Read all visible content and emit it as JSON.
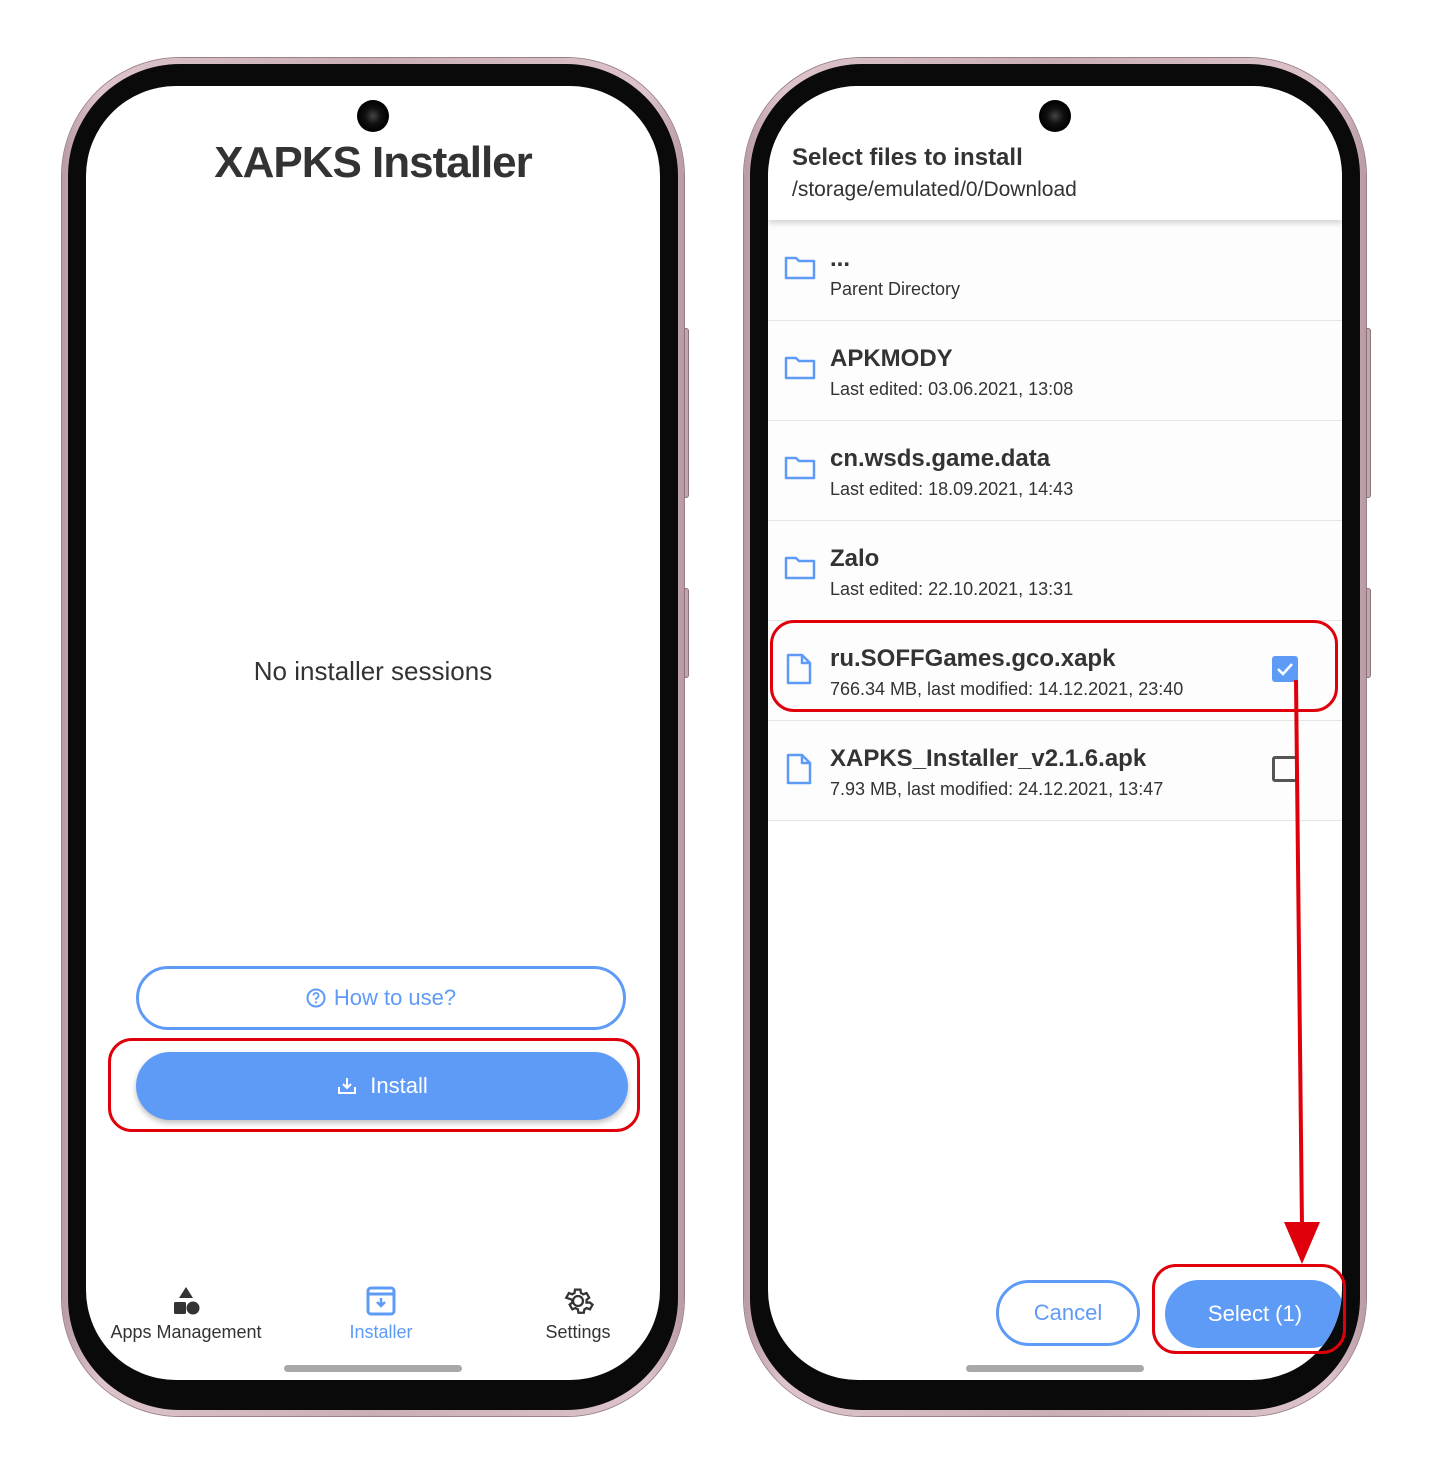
{
  "left_screen": {
    "app_title": "XAPKS Installer",
    "empty_state": "No installer sessions",
    "how_to_use_label": "How to use?",
    "install_label": "Install",
    "nav": [
      {
        "label": "Apps Management",
        "icon": "shapes-icon",
        "active": false
      },
      {
        "label": "Installer",
        "icon": "installer-icon",
        "active": true
      },
      {
        "label": "Settings",
        "icon": "gear-icon",
        "active": false
      }
    ]
  },
  "right_screen": {
    "dialog_title": "Select files to install",
    "path": "/storage/emulated/0/Download",
    "items": [
      {
        "type": "folder",
        "name": "...",
        "meta": "Parent Directory"
      },
      {
        "type": "folder",
        "name": "APKMODY",
        "meta": "Last edited: 03.06.2021, 13:08"
      },
      {
        "type": "folder",
        "name": "cn.wsds.game.data",
        "meta": "Last edited: 18.09.2021, 14:43"
      },
      {
        "type": "folder",
        "name": "Zalo",
        "meta": "Last edited: 22.10.2021, 13:31"
      },
      {
        "type": "file",
        "name": "ru.SOFFGames.gco.xapk",
        "meta": "766.34 MB, last modified: 14.12.2021, 23:40",
        "checked": true
      },
      {
        "type": "file",
        "name": "XAPKS_Installer_v2.1.6.apk",
        "meta": "7.93 MB, last modified: 24.12.2021, 13:47",
        "checked": false
      }
    ],
    "cancel_label": "Cancel",
    "select_label": "Select (1)"
  },
  "colors": {
    "accent": "#5e9bf7",
    "annotation": "#e0000b",
    "text": "#333333",
    "frame": "#c9aeb5"
  }
}
